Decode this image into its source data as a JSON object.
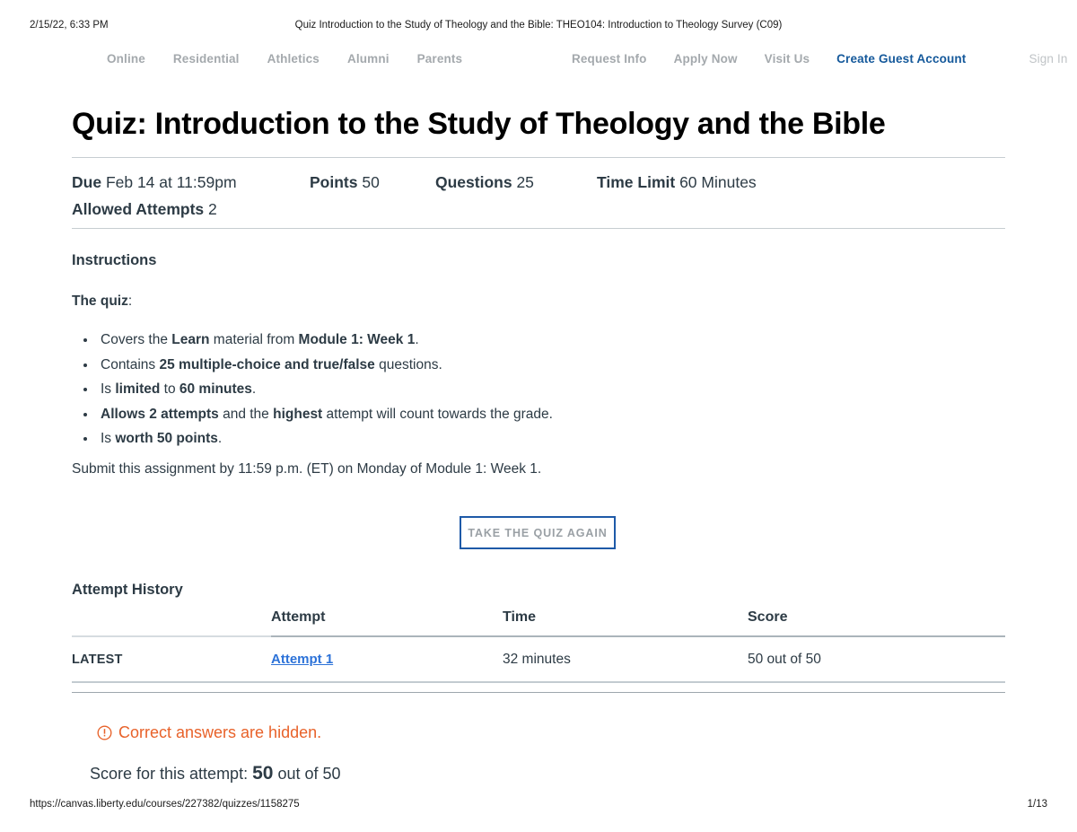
{
  "print_header": {
    "date": "2/15/22, 6:33 PM",
    "title": "Quiz Introduction to the Study of Theology and the Bible: THEO104: Introduction to Theology Survey (C09)"
  },
  "topnav": {
    "left_items": [
      {
        "label": "Online"
      },
      {
        "label": "Residential"
      },
      {
        "label": "Athletics"
      },
      {
        "label": "Alumni"
      },
      {
        "label": "Parents"
      }
    ],
    "right_items": [
      {
        "label": "Request Info"
      },
      {
        "label": "Apply Now"
      },
      {
        "label": "Visit Us"
      },
      {
        "label": "Create Guest Account"
      }
    ],
    "signin_label": "Sign In",
    "accent_color": "#15599b",
    "muted_color": "#a4a9ad"
  },
  "page_title": "Quiz: Introduction to the Study of Theology and the Bible",
  "meta": {
    "due_label": "Due",
    "due_value": "Feb 14 at 11:59pm",
    "points_label": "Points",
    "points_value": "50",
    "questions_label": "Questions",
    "questions_value": "25",
    "time_limit_label": "Time Limit",
    "time_limit_value": "60 Minutes",
    "allowed_attempts_label": "Allowed Attempts",
    "allowed_attempts_value": "2"
  },
  "instructions": {
    "heading": "Instructions",
    "lead_bold": "The quiz",
    "lead_rest": ":",
    "bullets": [
      {
        "p1": "Covers the ",
        "b1": "Learn",
        "p2": " material from ",
        "b2": "Module 1: Week 1",
        "p3": "."
      },
      {
        "p1": "Contains ",
        "b1": "25 multiple-choice and true/false",
        "p2": " questions.",
        "b2": "",
        "p3": ""
      },
      {
        "p1": "Is ",
        "b1": "limited",
        "p2": " to ",
        "b2": "60 minutes",
        "p3": "."
      },
      {
        "p1": "",
        "b1": "Allows 2 attempts",
        "p2": " and the ",
        "b2": "highest",
        "p3": " attempt will count towards the grade."
      },
      {
        "p1": "Is ",
        "b1": "worth 50 points",
        "p2": ".",
        "b2": "",
        "p3": ""
      }
    ],
    "submit_note": "Submit this assignment by 11:59 p.m. (ET) on Monday of Module 1: Week 1."
  },
  "take_quiz_button": {
    "label": "Take the Quiz Again",
    "border_color": "#1e5aa8",
    "text_color": "#9aa0a5"
  },
  "attempt_history": {
    "heading": "Attempt History",
    "columns": {
      "flag": "",
      "attempt": "Attempt",
      "time": "Time",
      "score": "Score"
    },
    "rows": [
      {
        "flag": "LATEST",
        "attempt": "Attempt 1 ",
        "time": "32 minutes",
        "score": "50 out of 50"
      }
    ],
    "link_color": "#2c72d8"
  },
  "answers_warning": {
    "icon": "exclamation-circle-icon",
    "text": "Correct answers are hidden.",
    "color": "#e8622a"
  },
  "score_summary": {
    "prefix": "Score for this attempt:",
    "value": "50",
    "suffix": "out of 50"
  },
  "print_footer": {
    "url": "https://canvas.liberty.edu/courses/227382/quizzes/1158275",
    "page": "1/13"
  }
}
